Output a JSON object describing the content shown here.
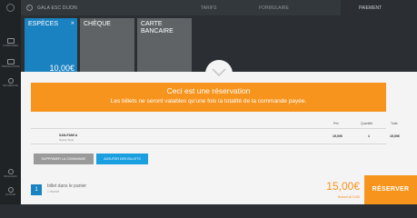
{
  "sidebar": {
    "items": [
      {
        "label": "COMMANDES",
        "icon": "orders-icon"
      },
      {
        "label": "TRANSACTIONS",
        "icon": "transactions-icon"
      },
      {
        "label": "RECHERCHE",
        "icon": "search-icon"
      },
      {
        "label": "RÉGLAGES",
        "icon": "settings-icon"
      },
      {
        "label": "QUITTER",
        "icon": "power-icon"
      }
    ]
  },
  "header": {
    "event_title": "GALA ESC DIJON",
    "tabs": [
      "TARIFS",
      "FORMULAIRE",
      "PAIEMENT"
    ]
  },
  "payment_methods": [
    {
      "label": "ESPÈCES",
      "amount": "10,00€"
    },
    {
      "label": "CHÈQUE"
    },
    {
      "label": "CARTE BANCAIRE"
    }
  ],
  "banner": {
    "title": "Ceci est une réservation",
    "subtitle": "Les billets ne seront valables qu'une fois la totalité de la commande payée."
  },
  "table": {
    "headers": {
      "price": "Prix",
      "quantity": "Quantité",
      "total": "Total"
    },
    "rows": [
      {
        "name": "SAN-FAMI A",
        "sub": "Soirée Style",
        "price": "15,00€",
        "quantity": "1",
        "total": "15,00€"
      }
    ]
  },
  "actions": {
    "delete_order": "SUPPRIMER LA COMMANDE",
    "add_tickets": "AJOUTER DES BILLETS"
  },
  "footer": {
    "ticket_count": "1",
    "cart_label": "billet dans le panier",
    "cart_sub": "1 réservé",
    "total": "15,00€",
    "remaining": "Restant dû 5,00€",
    "reserve_button": "RÉSERVER"
  },
  "colors": {
    "accent": "#f7941d",
    "primary": "#1a82c1",
    "link_button": "#1a9fe0",
    "dark_bg": "#2b2f33"
  }
}
